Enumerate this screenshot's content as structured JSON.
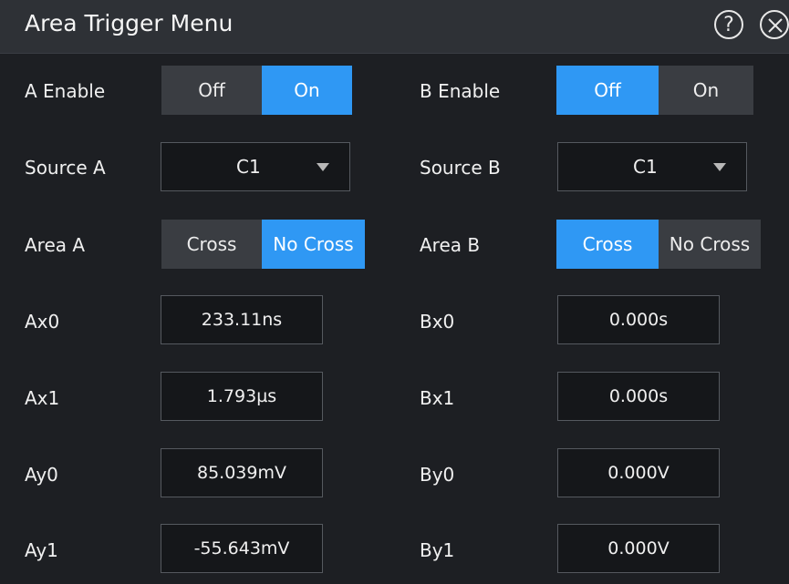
{
  "dialog": {
    "title": "Area Trigger Menu",
    "help_symbol": "?",
    "help_icon": "question-circle-icon",
    "close_icon": "close-circle-icon"
  },
  "colors": {
    "accent": "#2f98f4",
    "background": "#1d1f23",
    "titlebar": "#2e3136"
  },
  "a_enable": {
    "label": "A Enable",
    "off": "Off",
    "on": "On",
    "selected": "On"
  },
  "b_enable": {
    "label": "B Enable",
    "off": "Off",
    "on": "On",
    "selected": "Off"
  },
  "source_a": {
    "label": "Source A",
    "value": "C1"
  },
  "source_b": {
    "label": "Source B",
    "value": "C1"
  },
  "area_a": {
    "label": "Area A",
    "cross": "Cross",
    "no_cross": "No Cross",
    "selected": "No Cross"
  },
  "area_b": {
    "label": "Area B",
    "cross": "Cross",
    "no_cross": "No Cross",
    "selected": "Cross"
  },
  "ax0": {
    "label": "Ax0",
    "value": "233.11ns"
  },
  "ax1": {
    "label": "Ax1",
    "value": "1.793µs"
  },
  "ay0": {
    "label": "Ay0",
    "value": "85.039mV"
  },
  "ay1": {
    "label": "Ay1",
    "value": "-55.643mV"
  },
  "bx0": {
    "label": "Bx0",
    "value": "0.000s"
  },
  "bx1": {
    "label": "Bx1",
    "value": "0.000s"
  },
  "by0": {
    "label": "By0",
    "value": "0.000V"
  },
  "by1": {
    "label": "By1",
    "value": "0.000V"
  }
}
